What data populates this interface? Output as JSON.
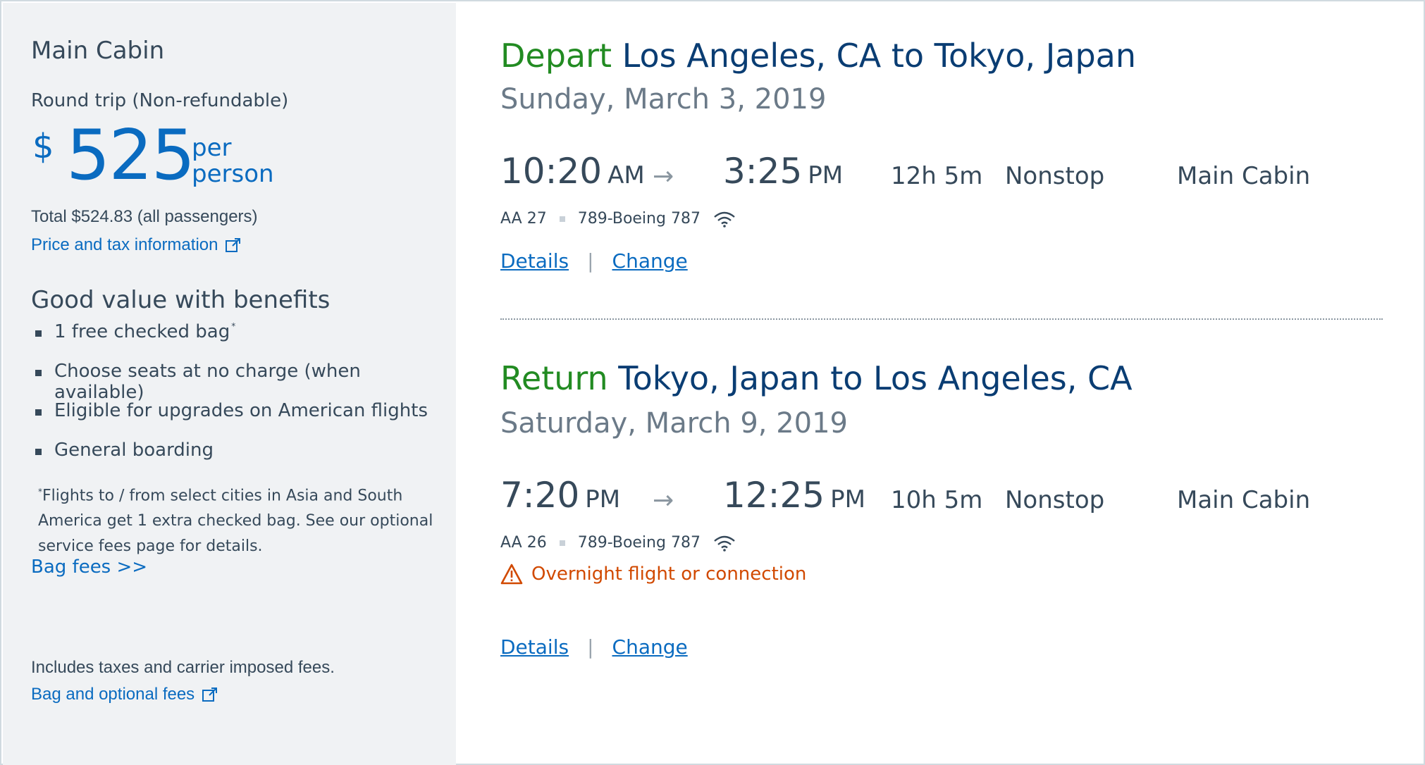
{
  "fare": {
    "cabin_title": "Main Cabin",
    "trip_type": "Round trip (Non-refundable)",
    "currency": "$",
    "amount": "525",
    "per_line1": "per",
    "per_line2": "person",
    "total": "Total $524.83 (all passengers)",
    "price_tax_link": "Price and tax information"
  },
  "benefits": {
    "title": "Good value with benefits",
    "items": [
      "1 free checked bag",
      "Choose seats at no charge (when available)",
      "Eligible for upgrades on American flights",
      "General boarding"
    ],
    "footnote_star": "*",
    "footnote": "Flights to / from select cities in Asia and South America get 1 extra checked bag. See our optional service fees page for details.",
    "bag_fees_link": "Bag fees >>"
  },
  "footer": {
    "includes": "Includes taxes and carrier imposed fees.",
    "bag_optional_link": "Bag and optional fees"
  },
  "legs": [
    {
      "direction": "Depart",
      "route": "Los Angeles, CA to Tokyo, Japan",
      "date": "Sunday, March 3, 2019",
      "depart_time": "10:20",
      "depart_ampm": "AM",
      "arrive_time": "3:25",
      "arrive_ampm": "PM",
      "duration": "12h  5m",
      "stops": "Nonstop",
      "cabin": "Main Cabin",
      "flight_number": "AA 27",
      "aircraft": "789-Boeing 787",
      "details_link": "Details",
      "change_link": "Change"
    },
    {
      "direction": "Return",
      "route": "Tokyo, Japan to Los Angeles, CA",
      "date": "Saturday, March 9, 2019",
      "depart_time": "7:20",
      "depart_ampm": "PM",
      "arrive_time": "12:25",
      "arrive_ampm": "PM",
      "duration": "10h  5m",
      "stops": "Nonstop",
      "cabin": "Main Cabin",
      "flight_number": "AA 26",
      "aircraft": "789-Boeing 787",
      "warning": "Overnight flight or connection",
      "details_link": "Details",
      "change_link": "Change"
    }
  ],
  "separator": "|",
  "arrow_glyph": "→",
  "icons": [
    "external-link-icon",
    "wifi-icon",
    "warning-icon",
    "arrow-right-icon"
  ],
  "colors": {
    "link_blue": "#0a6bc0",
    "title_navy": "#0a3d73",
    "direction_green": "#228b22",
    "warning_orange": "#d14900",
    "panel_gray": "#f0f2f4"
  }
}
